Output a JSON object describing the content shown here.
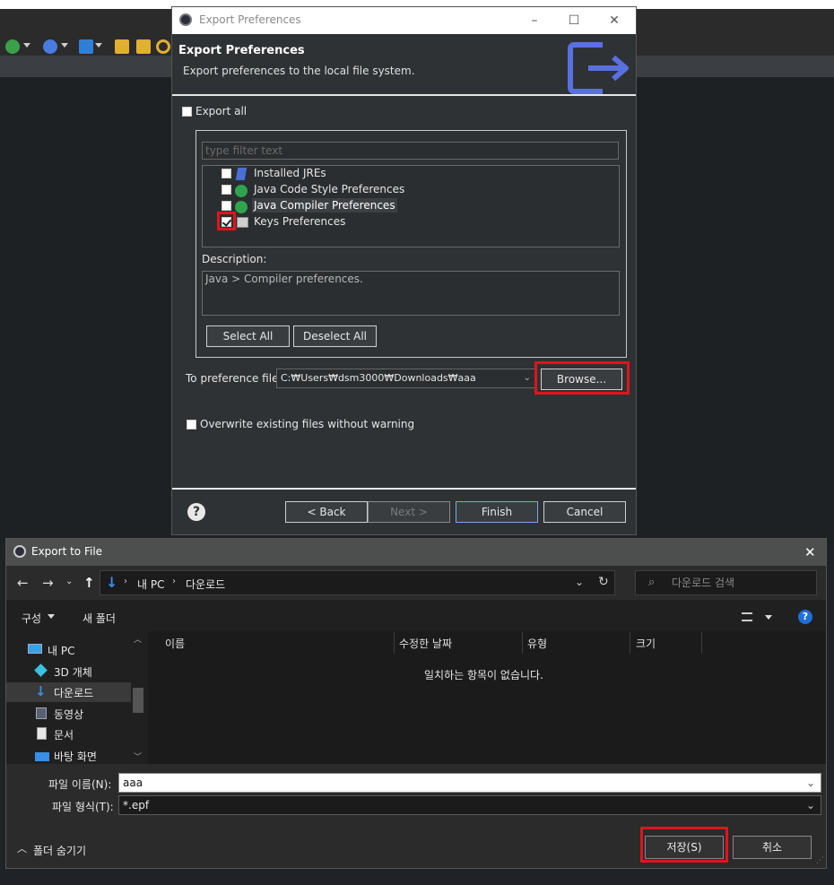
{
  "pref_dialog": {
    "window_title": "Export Preferences",
    "header_title": "Export Preferences",
    "header_desc": "Export preferences to the local file system.",
    "export_all": "Export all",
    "filter_placeholder": "type filter text",
    "items": [
      {
        "label": "Installed JREs",
        "checked": false
      },
      {
        "label": "Java Code Style Preferences",
        "checked": false
      },
      {
        "label": "Java Compiler Preferences",
        "checked": false
      },
      {
        "label": "Keys Preferences",
        "checked": true
      }
    ],
    "description_label": "Description:",
    "description_text": "Java > Compiler preferences.",
    "select_all": "Select All",
    "deselect_all": "Deselect All",
    "to_file_label": "To preference file:",
    "to_file_value": "C:₩Users₩dsm3000₩Downloads₩aaa",
    "browse": "Browse...",
    "overwrite": "Overwrite existing files without warning",
    "back": "< Back",
    "next": "Next >",
    "finish": "Finish",
    "cancel": "Cancel",
    "help": "?"
  },
  "save_dialog": {
    "window_title": "Export to File",
    "breadcrumb": [
      "내 PC",
      "다운로드"
    ],
    "search_placeholder": "다운로드 검색",
    "organize": "구성",
    "new_folder": "새 폴더",
    "nav_items": [
      "내 PC",
      "3D 개체",
      "다운로드",
      "동영상",
      "문서",
      "바탕 화면"
    ],
    "columns": [
      "이름",
      "수정한 날짜",
      "유형",
      "크기"
    ],
    "empty_message": "일치하는 항목이 없습니다.",
    "filename_label": "파일 이름(N):",
    "filename_value": "aaa",
    "filetype_label": "파일 형식(T):",
    "filetype_value": "*.epf",
    "hide_folders": "폴더 숨기기",
    "save": "저장(S)",
    "cancel": "취소"
  },
  "colors": {
    "highlight_red": "#e0141e",
    "export_icon": "#5a6fe0"
  }
}
